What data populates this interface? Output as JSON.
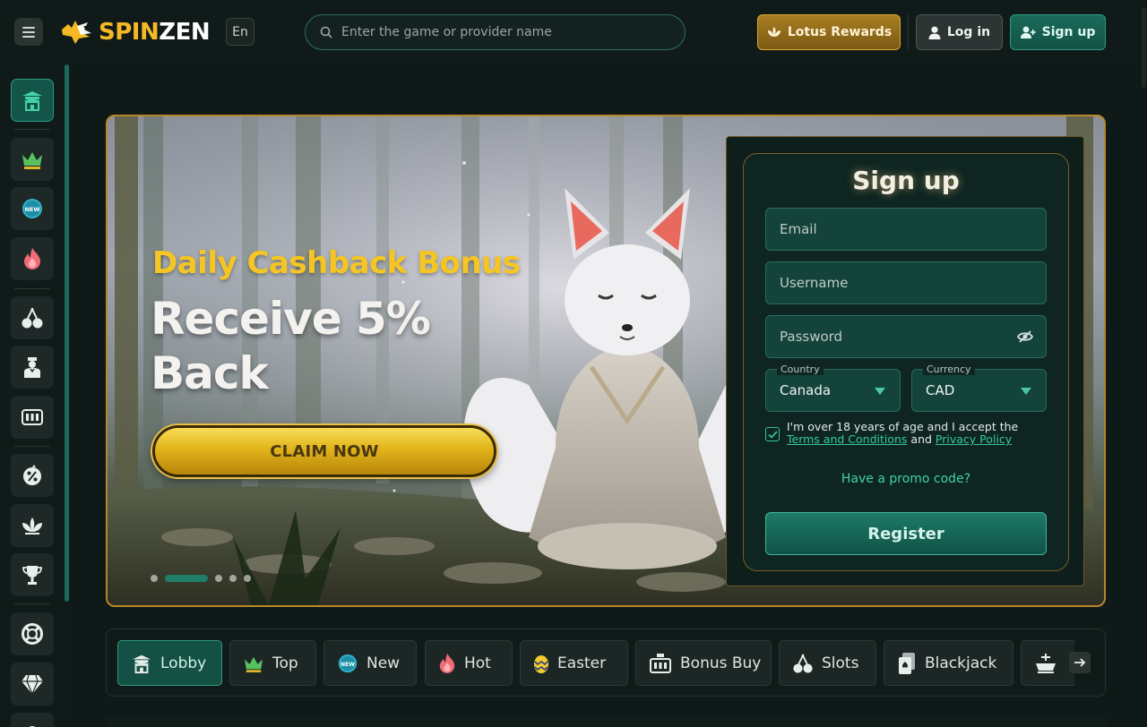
{
  "header": {
    "logo_spin": "SPIN",
    "logo_zen": "ZEN",
    "language": "En",
    "search_placeholder": "Enter the game or provider name",
    "lotus_rewards": "Lotus Rewards",
    "login": "Log in",
    "signup": "Sign up"
  },
  "sidebar": {
    "items": [
      "lobby-pagoda-icon",
      "crown-icon",
      "new-badge-icon",
      "flame-icon",
      "cherries-icon",
      "live-dealer-icon",
      "bonus-buy-icon",
      "percent-icon",
      "lotus-icon",
      "trophy-icon",
      "lifebuoy-icon",
      "diamond-icon"
    ]
  },
  "hero": {
    "subtitle": "Daily Cashback Bonus",
    "title": "Receive 5% Back",
    "cta": "CLAIM NOW",
    "slides": 5,
    "active_slide": 2
  },
  "signup_form": {
    "title": "Sign up",
    "email_placeholder": "Email",
    "username_placeholder": "Username",
    "password_placeholder": "Password",
    "country_label": "Country",
    "country_value": "Canada",
    "currency_label": "Currency",
    "currency_value": "CAD",
    "terms_prefix": "I'm over 18 years of age and I accept the ",
    "terms_link": "Terms and Conditions",
    "terms_and": " and ",
    "privacy_link": "Privacy Policy",
    "terms_checked": true,
    "promo": "Have a promo code?",
    "register": "Register"
  },
  "categories": [
    {
      "label": "Lobby",
      "icon": "pagoda-icon",
      "active": true
    },
    {
      "label": "Top",
      "icon": "crown-icon"
    },
    {
      "label": "New",
      "icon": "new-badge-icon"
    },
    {
      "label": "Hot",
      "icon": "flame-icon"
    },
    {
      "label": "Easter",
      "icon": "easter-egg-icon"
    },
    {
      "label": "Bonus Buy",
      "icon": "bonus-buy-icon"
    },
    {
      "label": "Slots",
      "icon": "cherries-icon"
    },
    {
      "label": "Blackjack",
      "icon": "cards-icon"
    },
    {
      "label": "",
      "icon": "roulette-icon"
    }
  ],
  "colors": {
    "background": "#0f1a18",
    "accent": "#1f7d68",
    "gold": "#f5c623",
    "brand_spin": "#f5b926"
  }
}
